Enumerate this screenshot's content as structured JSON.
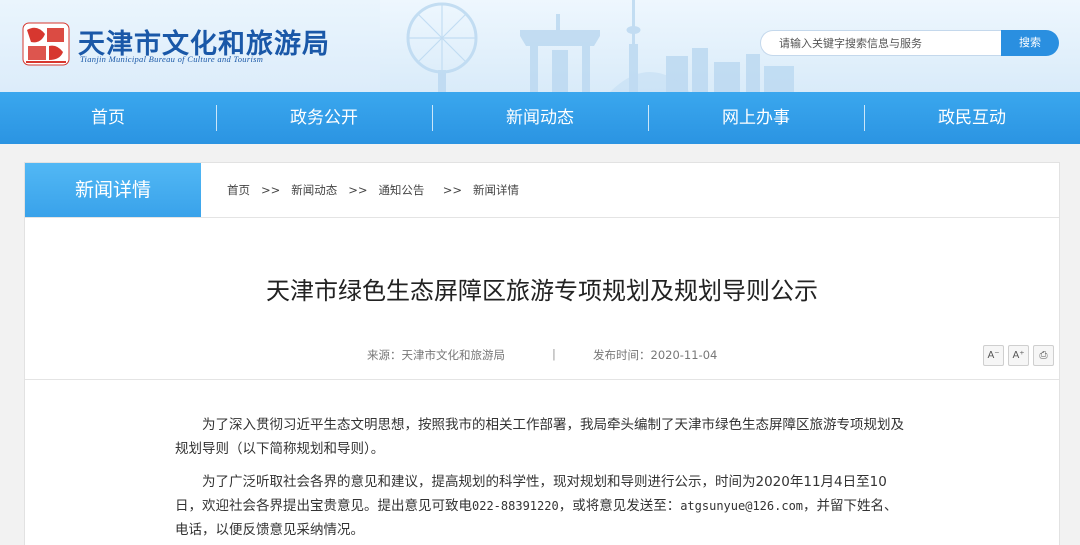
{
  "header": {
    "logo_emblem_text": "天津",
    "logo_title": "天津市文化和旅游局",
    "logo_subtitle": "Tianjin Municipal Bureau of Culture and Tourism",
    "search_placeholder": "请输入关键字搜索信息与服务",
    "search_button": "搜索"
  },
  "nav": {
    "items": [
      "首页",
      "政务公开",
      "新闻动态",
      "网上办事",
      "政民互动"
    ]
  },
  "section": {
    "tab_label": "新闻详情",
    "breadcrumb": [
      "首页",
      ">>",
      "新闻动态",
      ">>",
      "通知公告",
      ">>",
      "新闻详情"
    ]
  },
  "article": {
    "title": "天津市绿色生态屏障区旅游专项规划及规划导则公示",
    "source": "来源：天津市文化和旅游局",
    "separator": "|",
    "date": "发布时间：2020-11-04",
    "tools": {
      "font_smaller": "A⁻",
      "font_larger": "A⁺",
      "print": "⎙"
    },
    "paragraph1": "为了深入贯彻习近平生态文明思想，按照我市的相关工作部署，我局牵头编制了天津市绿色生态屏障区旅游专项规划及规划导则（以下简称规划和导则）。",
    "paragraph2_a": "为了广泛听取社会各界的意见和建议，提高规划的科学性，现对规划和导则进行公示，时间为2020年11月4日至10日，欢迎社会各界提出宝贵意见。提出意见可致电",
    "phone": "022-88391220",
    "paragraph2_b": "，或将意见发送至：",
    "email": "atgsunyue@126.com",
    "paragraph2_c": "，并留下姓名、电话，以便反馈意见采纳情况。"
  },
  "colors": {
    "nav_blue": "#2b94e2",
    "tab_blue": "#39a2ea",
    "logo_blue": "#1a58a8",
    "emblem_red": "#d7372f"
  }
}
